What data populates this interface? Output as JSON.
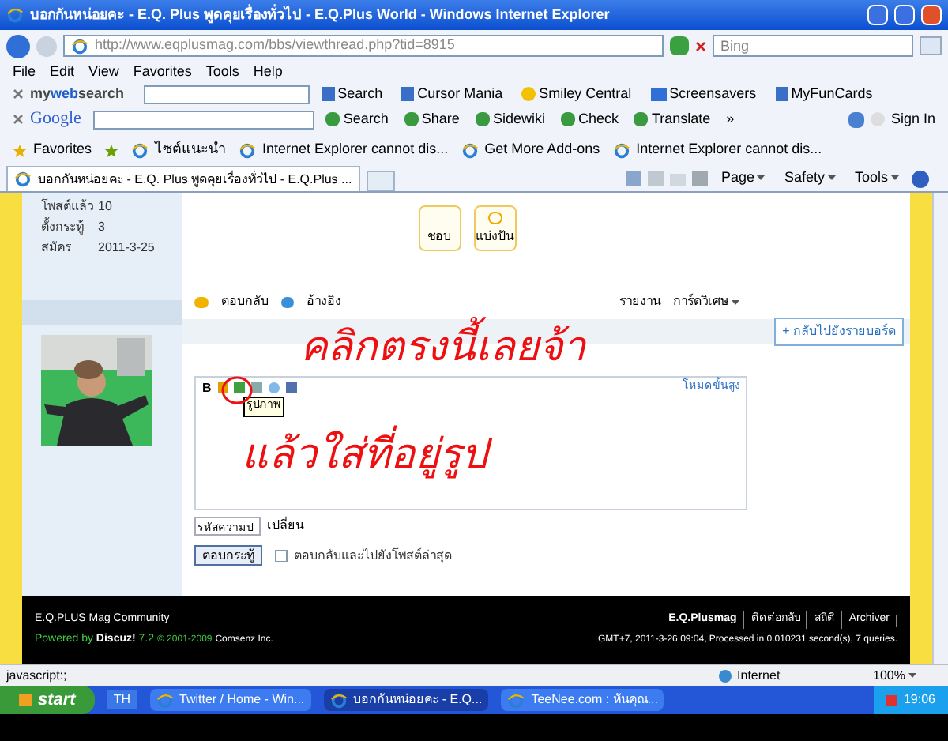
{
  "window": {
    "title": "บอกกันหน่อยคะ - E.Q. Plus พูดคุยเรื่องทั่วไป - E.Q.Plus World - Windows Internet Explorer"
  },
  "address": {
    "url_host": "http://www.eqplusmag.com",
    "url_path": "/bbs/viewthread.php?tid=8915",
    "search_placeholder": "Bing"
  },
  "menu": [
    "File",
    "Edit",
    "View",
    "Favorites",
    "Tools",
    "Help"
  ],
  "toolbar_1": {
    "brand_a": "my",
    "brand_b": "web",
    "brand_c": "search",
    "items": [
      "Search",
      "Cursor Mania",
      "Smiley Central",
      "Screensavers",
      "MyFunCards"
    ]
  },
  "toolbar_2": {
    "brand": "Google",
    "items": [
      "Search",
      "Share",
      "Sidewiki",
      "Check",
      "Translate",
      "»"
    ],
    "sign_in": "Sign In"
  },
  "favorites_bar": {
    "label": "Favorites",
    "items": [
      "ไซต์แนะนำ",
      "Internet Explorer cannot dis...",
      "Get More Add-ons",
      "Internet Explorer cannot dis..."
    ]
  },
  "tab": {
    "title": "บอกกันหน่อยคะ - E.Q. Plus พูดคุยเรื่องทั่วไป - E.Q.Plus ..."
  },
  "command_bar": [
    "Page",
    "Safety",
    "Tools"
  ],
  "profile": [
    {
      "label": "โพสต์แล้ว",
      "value": "10"
    },
    {
      "label": "ตั้งกระทู้",
      "value": "3"
    },
    {
      "label": "สมัคร",
      "value": "2011-3-25"
    }
  ],
  "post_buttons": [
    "ชอบ",
    "แบ่งปัน"
  ],
  "post_actions": {
    "reply": "ตอบกลับ",
    "quote": "อ้างอิง",
    "report": "รายงาน",
    "card": "การ์ดวิเศษ"
  },
  "back_link": "+ กลับไปยังรายบอร์ด",
  "editor": {
    "bold": "B",
    "tooltip": "รูปภาพ",
    "advanced": "โหมดขั้นสูง",
    "captcha_value": "รหัสความป",
    "captcha_change": "เปลี่ยน",
    "submit": "ตอบกระทู้",
    "jump_label": "ตอบกลับและไปยังโพสต์ล่าสุด",
    "jump_checked": false
  },
  "annotation": {
    "line_1": "คลิกตรงนี้เลยจ้า",
    "line_2": "แล้วใส่ที่อยู่รูป"
  },
  "footer": {
    "site": "E.Q.PLUS Mag Community",
    "powered": "Powered by",
    "product": "Discuz!",
    "version": "7.2",
    "copyright": "© 2001-2009",
    "company": "Comsenz Inc.",
    "brand": "E.Q.Plusmag",
    "links": [
      "ติดต่อกลับ",
      "สถิติ",
      "Archiver"
    ],
    "stats": "GMT+7, 2011-3-26 09:04, Processed in 0.010231 second(s), 7 queries."
  },
  "status_bar": {
    "text": "javascript:;",
    "zone": "Internet",
    "zoom": "100%"
  },
  "taskbar": {
    "start": "start",
    "language": "TH",
    "tasks": [
      {
        "label": "Twitter / Home - Win...",
        "selected": false
      },
      {
        "label": "บอกกันหน่อยคะ - E.Q...",
        "selected": true
      },
      {
        "label": "TeeNee.com : หันคุณ...",
        "selected": false
      }
    ],
    "clock": "19:06"
  }
}
